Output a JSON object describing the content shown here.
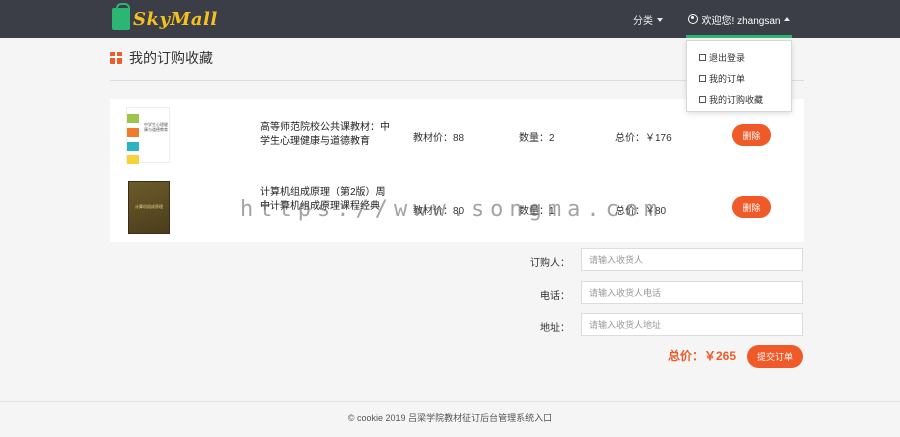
{
  "nav": {
    "logo": "SkyMall",
    "category": "分类",
    "user": "欢迎您! zhangsan"
  },
  "dropdown": [
    {
      "label": "退出登录",
      "icon": "logout-icon"
    },
    {
      "label": "我的订单",
      "icon": "list-icon"
    },
    {
      "label": "我的订购收藏",
      "icon": "cart-icon"
    }
  ],
  "page": {
    "title": "我的订购收藏",
    "icon": "gift-icon"
  },
  "items": [
    {
      "cover_text": "中学生心理健康与道德教育",
      "name": "高等师范院校公共课教材：中学生心理健康与道德教育",
      "price": "教材价：88",
      "qty": "数量：2",
      "total": "总价：￥176",
      "delete": "删除"
    },
    {
      "cover_text": "计算机组成原理",
      "name": "计算机组成原理（第2版）周中计算机组成原理课程经典",
      "price": "教材价：80",
      "qty": "数量：1",
      "total": "总价：￥80",
      "delete": "删除"
    }
  ],
  "form": {
    "buyer_label": "订购人：",
    "buyer_placeholder": "请输入收货人",
    "phone_label": "电话：",
    "phone_placeholder": "请输入收货人电话",
    "address_label": "地址：",
    "address_placeholder": "请输入收货人地址",
    "sum": "总价：￥265",
    "submit": "提交订单"
  },
  "watermark": "https://www.songma.com",
  "footer": {
    "copyright": "© cookie 2019",
    "link": "吕梁学院教材征订后台管理系统入口"
  },
  "colors": {
    "navbar": "#3b3e47",
    "accent": "#f05a28",
    "active": "#2bb673"
  }
}
